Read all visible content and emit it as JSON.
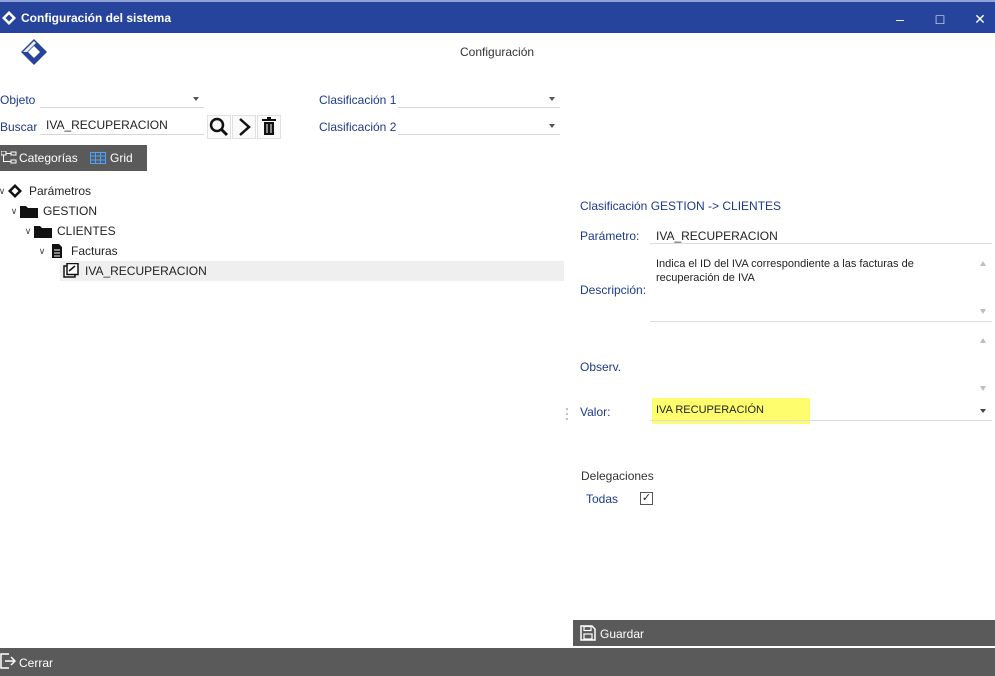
{
  "window": {
    "title": "Configuración del sistema",
    "controls": {
      "minimize": "–",
      "maximize": "□",
      "close": "✕"
    }
  },
  "header": {
    "title": "Configuración"
  },
  "filters": {
    "objeto_label": "Objeto",
    "objeto_value": "",
    "buscar_label": "Buscar",
    "buscar_value": "IVA_RECUPERACION",
    "clasificacion1_label": "Clasificación 1",
    "clasificacion1_value": "",
    "clasificacion2_label": "Clasificación 2",
    "clasificacion2_value": ""
  },
  "tabs": [
    {
      "label": "Categorías",
      "icon": "tree-icon"
    },
    {
      "label": "Grid",
      "icon": "grid-icon"
    }
  ],
  "tree": {
    "root": "Parámetros",
    "level1": "GESTION",
    "level2": "CLIENTES",
    "level3": "Facturas",
    "leaf": "IVA_RECUPERACION"
  },
  "detail": {
    "clasificacion_title": "Clasificación GESTION -> CLIENTES",
    "parametro_label": "Parámetro:",
    "parametro_value": "IVA_RECUPERACION",
    "descripcion_label": "Descripción:",
    "descripcion_value": "Indica el ID del IVA correspondiente a las facturas de recuperación de IVA",
    "observ_label": "Observ.",
    "observ_value": "",
    "valor_label": "Valor:",
    "valor_value": "IVA RECUPERACIÓN",
    "delegaciones_label": "Delegaciones",
    "todas_label": "Todas",
    "todas_checked": "✓"
  },
  "actions": {
    "guardar": "Guardar",
    "cerrar": "Cerrar"
  },
  "colors": {
    "titlebar": "#27449c",
    "label_blue": "#1d3a8a",
    "toolbar_gray": "#5a5a5a",
    "highlight_yellow": "#fdfd6e"
  }
}
